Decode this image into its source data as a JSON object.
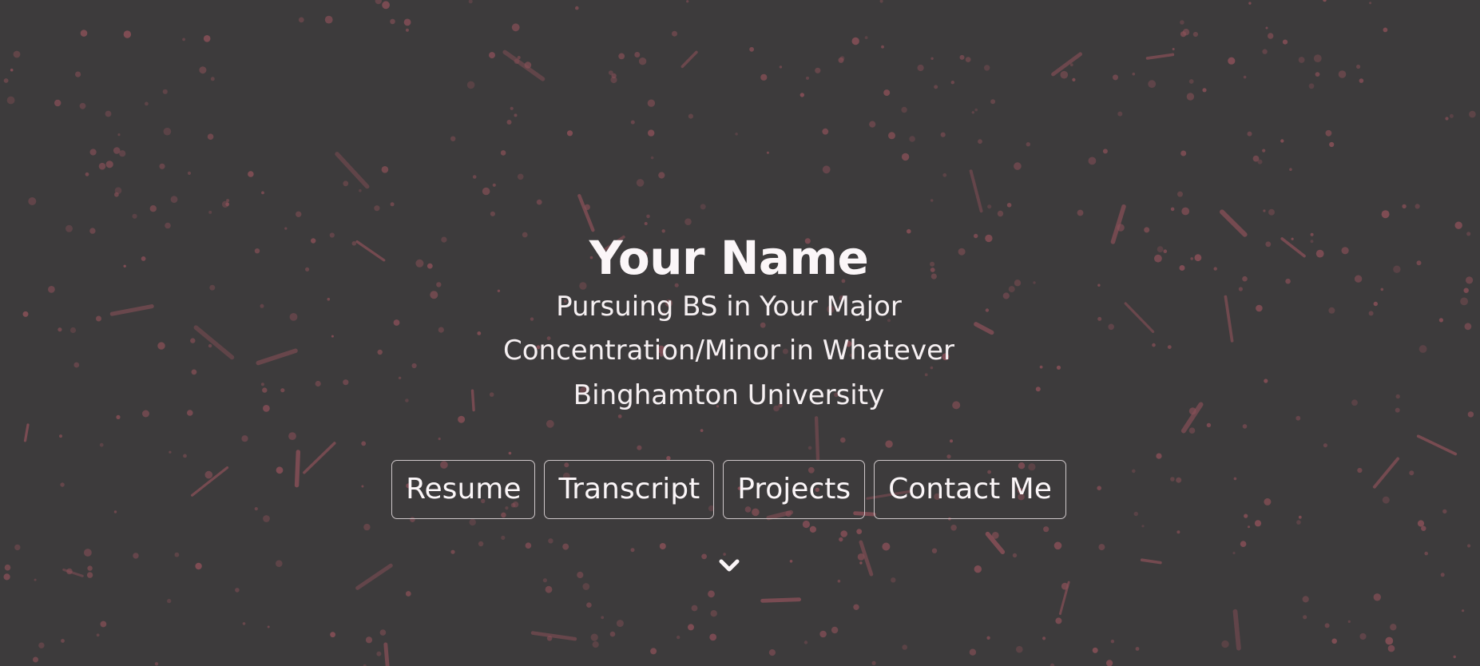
{
  "hero": {
    "name": "Your Name",
    "degree": "Pursuing BS in Your Major",
    "concentration": "Concentration/Minor in Whatever",
    "school": "Binghamton University"
  },
  "nav_buttons": [
    {
      "label": "Resume"
    },
    {
      "label": "Transcript"
    },
    {
      "label": "Projects"
    },
    {
      "label": "Contact Me"
    }
  ],
  "scroll_indicator": {
    "icon": "chevron-down-icon"
  },
  "colors": {
    "background": "#3d3b3c",
    "particle": "#8a5058",
    "text": "#f4eef0",
    "button_border": "#cfc8ca"
  }
}
